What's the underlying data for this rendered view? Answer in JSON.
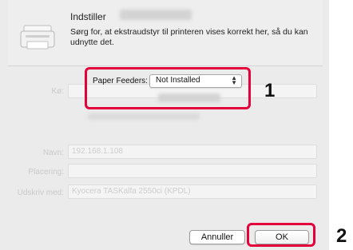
{
  "sheet": {
    "title": "Indstiller",
    "description": "Sørg for, at ekstraudstyr til printeren vises korrekt her, så du kan udnytte det."
  },
  "option": {
    "label": "Paper Feeders:",
    "value": "Not Installed"
  },
  "background": {
    "kind_label": "Kø:",
    "name_label": "Navn:",
    "name_value": "192.168.1.108",
    "location_label": "Placering:",
    "driver_label": "Udskriv med:",
    "driver_value": "Kyocera TASKalfa 2550ci (KPDL)"
  },
  "buttons": {
    "cancel": "Annuller",
    "ok": "OK"
  },
  "callouts": {
    "first": "1",
    "second": "2"
  },
  "colors": {
    "callout": "#e4003a",
    "dialog": "#ebebeb"
  }
}
